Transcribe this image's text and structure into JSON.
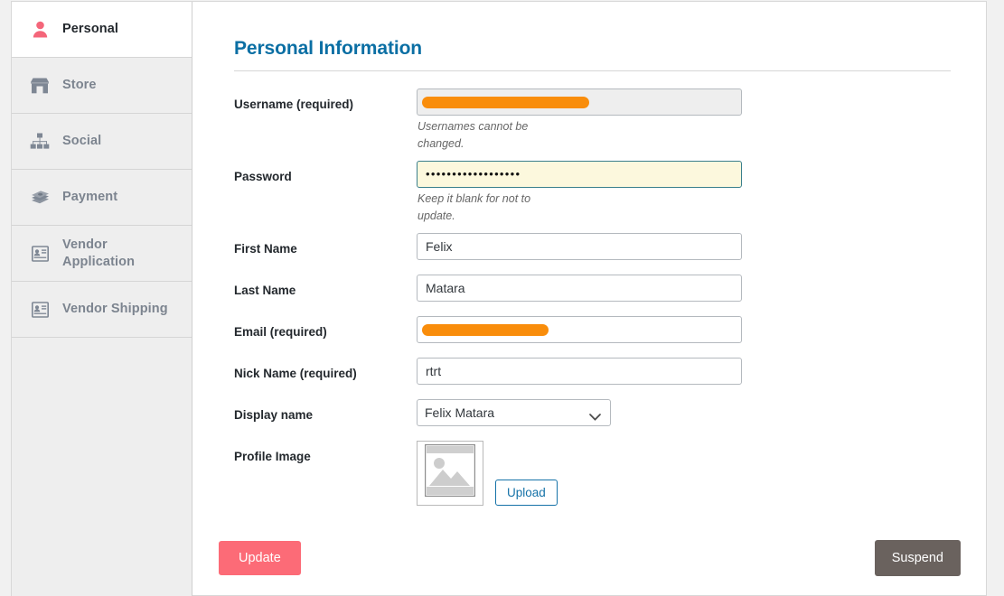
{
  "sidebar": {
    "items": [
      {
        "label": "Personal",
        "icon": "user-icon",
        "active": true
      },
      {
        "label": "Store",
        "icon": "shop-icon",
        "active": false
      },
      {
        "label": "Social",
        "icon": "sitemap-icon",
        "active": false
      },
      {
        "label": "Payment",
        "icon": "money-stack-icon",
        "active": false
      },
      {
        "label": "Vendor Application",
        "icon": "id-card-icon",
        "active": false
      },
      {
        "label": "Vendor Shipping",
        "icon": "id-card-icon",
        "active": false
      }
    ]
  },
  "main": {
    "title": "Personal Information",
    "fields": {
      "username": {
        "label": "Username (required)",
        "value": "",
        "redacted": true,
        "disabled": true,
        "hint": "Usernames cannot be changed."
      },
      "password": {
        "label": "Password",
        "value": "••••••••••••••••••",
        "hint": "Keep it blank for not to update."
      },
      "first_name": {
        "label": "First Name",
        "value": "Felix"
      },
      "last_name": {
        "label": "Last Name",
        "value": "Matara"
      },
      "email": {
        "label": "Email (required)",
        "value": "",
        "redacted": true
      },
      "nick_name": {
        "label": "Nick Name (required)",
        "value": "rtrt"
      },
      "display_name": {
        "label": "Display name",
        "value": "Felix Matara",
        "options": [
          "Felix Matara"
        ]
      },
      "profile_image": {
        "label": "Profile Image",
        "placeholder_icon": "broken-image-icon",
        "upload_label": "Upload"
      }
    }
  },
  "footer": {
    "update_label": "Update",
    "suspend_label": "Suspend"
  },
  "colors": {
    "title": "#0b6fa4",
    "update": "#fc6b77",
    "suspend": "#6a625e",
    "redaction": "#f98d0b",
    "active_icon": "#f4667a",
    "inactive_icon": "#7e8794"
  }
}
